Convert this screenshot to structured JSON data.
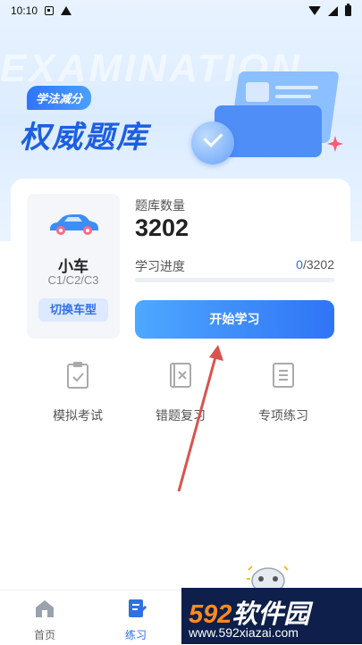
{
  "status_bar": {
    "time": "10:10"
  },
  "banner": {
    "bg_word": "EXAMINATION",
    "pill_label": "学法减分",
    "title": "权威题库"
  },
  "vehicle": {
    "name": "小车",
    "license": "C1/C2/C3",
    "switch_label": "切换车型"
  },
  "stats": {
    "count_label": "题库数量",
    "count_value": "3202",
    "progress_label": "学习进度",
    "progress_current": "0",
    "progress_total": "/3202",
    "progress_fraction": 0.0
  },
  "start_button_label": "开始学习",
  "features": [
    {
      "label": "模拟考试",
      "icon": "clipboard-check-icon"
    },
    {
      "label": "错题复习",
      "icon": "book-x-icon"
    },
    {
      "label": "专项练习",
      "icon": "list-doc-icon"
    }
  ],
  "tabs": [
    {
      "label": "首页",
      "icon": "home-icon",
      "active": false
    },
    {
      "label": "练习",
      "icon": "practice-icon",
      "active": true
    }
  ],
  "watermark": {
    "brand_num": "592",
    "brand_cn": "软件园",
    "url": "www.592xiazai.com"
  },
  "colors": {
    "accent": "#2f6fe8",
    "accent_light": "#dce9ff",
    "annotation": "#d9534f"
  }
}
